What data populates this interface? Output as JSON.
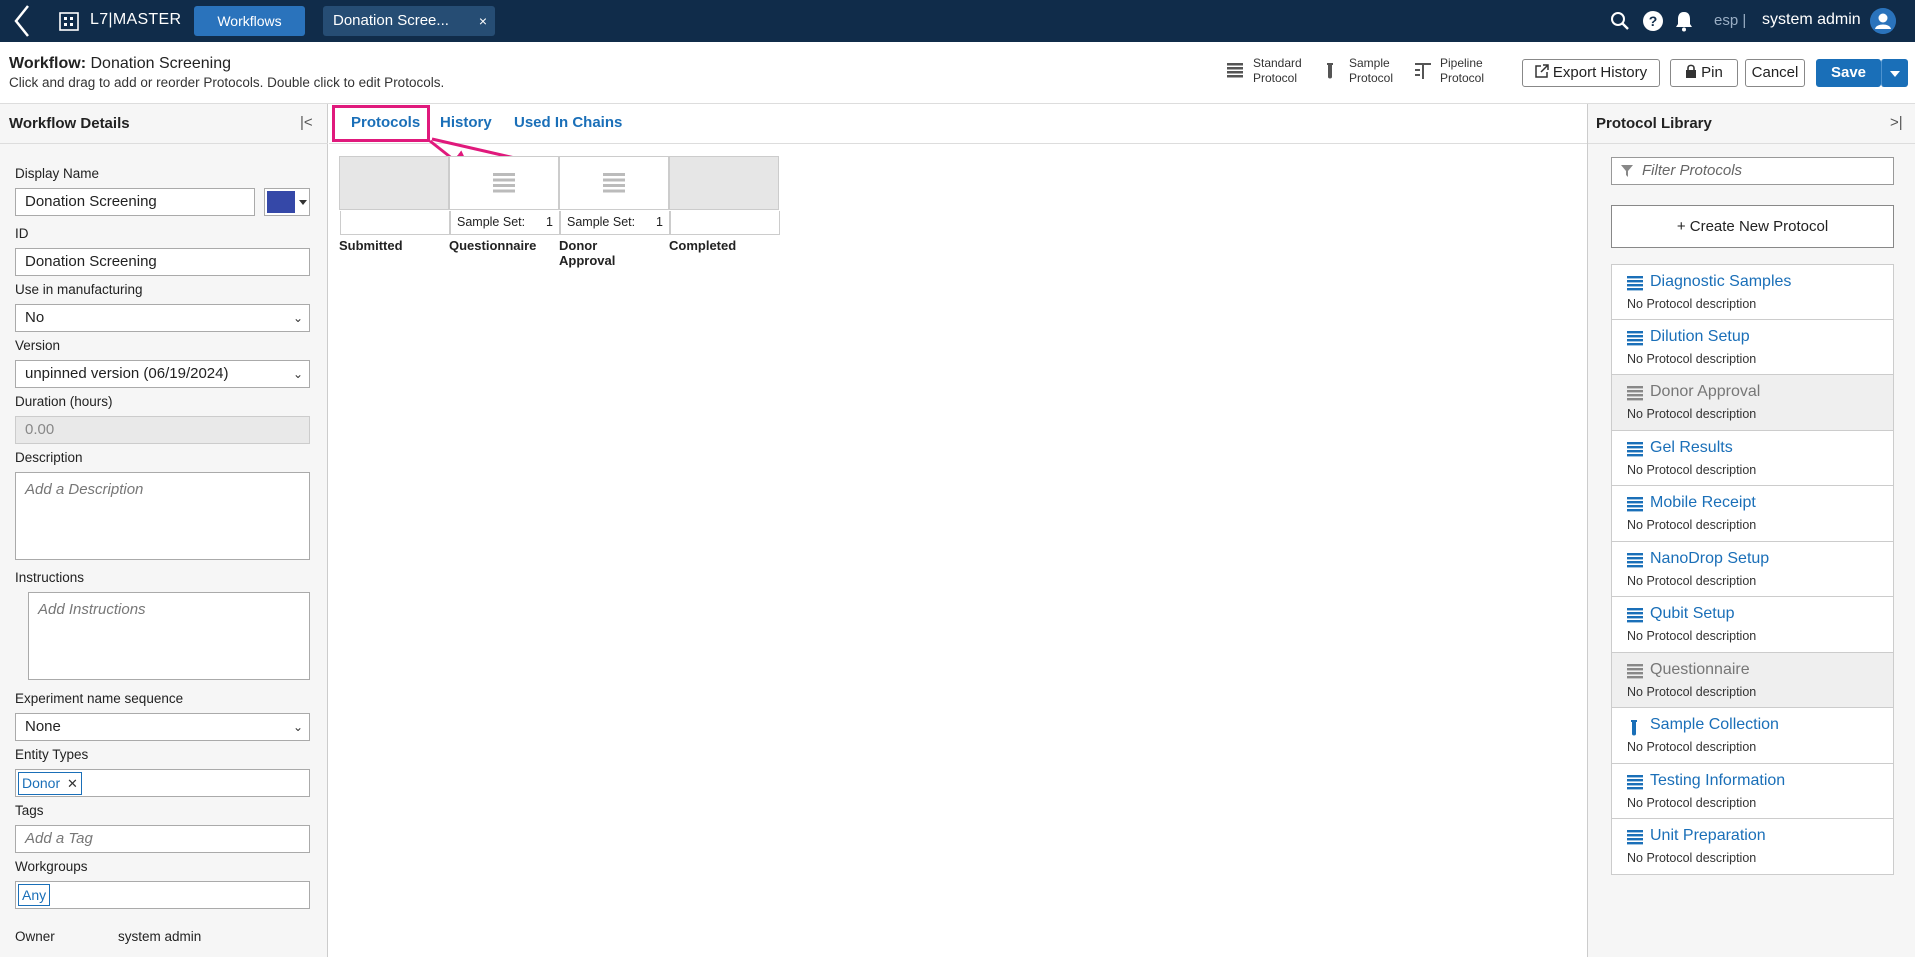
{
  "topbar": {
    "app_name": "L7|MASTER",
    "workflows_button": "Workflows",
    "open_tab": "Donation Scree...",
    "open_tab_close": "×",
    "help_glyph": "?",
    "lang": "esp |",
    "user": "system admin"
  },
  "header": {
    "title_prefix": "Workflow:",
    "title_value": "Donation Screening",
    "subtitle": "Click and drag to add or reorder Protocols. Double click to edit Protocols.",
    "protocol_types": [
      {
        "line1": "Standard",
        "line2": "Protocol"
      },
      {
        "line1": "Sample",
        "line2": "Protocol"
      },
      {
        "line1": "Pipeline",
        "line2": "Protocol"
      }
    ],
    "export_history": "Export History",
    "pin": "Pin",
    "cancel": "Cancel",
    "save": "Save"
  },
  "left_panel": {
    "title": "Workflow Details",
    "collapse_glyph": "|<",
    "display_name_label": "Display Name",
    "display_name_value": "Donation Screening",
    "color_swatch": "#3548a8",
    "id_label": "ID",
    "id_value": "Donation Screening",
    "manufacturing_label": "Use in manufacturing",
    "manufacturing_value": "No",
    "version_label": "Version",
    "version_value": "unpinned version (06/19/2024)",
    "duration_label": "Duration (hours)",
    "duration_placeholder": "0.00",
    "description_label": "Description",
    "description_placeholder": "Add a Description",
    "instructions_label": "Instructions",
    "instructions_placeholder": "Add Instructions",
    "exp_seq_label": "Experiment name sequence",
    "exp_seq_value": "None",
    "entity_types_label": "Entity Types",
    "entity_type_tag": "Donor",
    "entity_type_remove": "✕",
    "tags_label": "Tags",
    "tags_placeholder": "Add a Tag",
    "workgroups_label": "Workgroups",
    "workgroup_tag": "Any",
    "owner_label": "Owner",
    "owner_value": "system admin"
  },
  "center": {
    "tabs": [
      "Protocols",
      "History",
      "Used In Chains"
    ],
    "steps": [
      {
        "name": "Submitted",
        "sample_set_label": "",
        "sample_set_value": ""
      },
      {
        "name": "Questionnaire",
        "sample_set_label": "Sample Set:",
        "sample_set_value": "1"
      },
      {
        "name": "Donor Approval",
        "sample_set_label": "Sample Set:",
        "sample_set_value": "1"
      },
      {
        "name": "Completed",
        "sample_set_label": "",
        "sample_set_value": ""
      }
    ],
    "highlight_color": "#e0197c"
  },
  "right_panel": {
    "title": "Protocol Library",
    "expand_glyph": ">|",
    "filter_placeholder": "Filter Protocols",
    "create_button": "+  Create New Protocol",
    "protocols": [
      {
        "name": "Diagnostic Samples",
        "desc": "No Protocol description",
        "disabled": false,
        "icon": "standard-protocol-icon"
      },
      {
        "name": "Dilution Setup",
        "desc": "No Protocol description",
        "disabled": false,
        "icon": "standard-protocol-icon"
      },
      {
        "name": "Donor Approval",
        "desc": "No Protocol description",
        "disabled": true,
        "icon": "standard-protocol-icon"
      },
      {
        "name": "Gel Results",
        "desc": "No Protocol description",
        "disabled": false,
        "icon": "standard-protocol-icon"
      },
      {
        "name": "Mobile Receipt",
        "desc": "No Protocol description",
        "disabled": false,
        "icon": "standard-protocol-icon"
      },
      {
        "name": "NanoDrop Setup",
        "desc": "No Protocol description",
        "disabled": false,
        "icon": "standard-protocol-icon"
      },
      {
        "name": "Qubit Setup",
        "desc": "No Protocol description",
        "disabled": false,
        "icon": "standard-protocol-icon"
      },
      {
        "name": "Questionnaire",
        "desc": "No Protocol description",
        "disabled": true,
        "icon": "standard-protocol-icon"
      },
      {
        "name": "Sample Collection",
        "desc": "No Protocol description",
        "disabled": false,
        "icon": "sample-protocol-icon"
      },
      {
        "name": "Testing Information",
        "desc": "No Protocol description",
        "disabled": false,
        "icon": "standard-protocol-icon"
      },
      {
        "name": "Unit Preparation",
        "desc": "No Protocol description",
        "disabled": false,
        "icon": "standard-protocol-icon"
      }
    ]
  }
}
